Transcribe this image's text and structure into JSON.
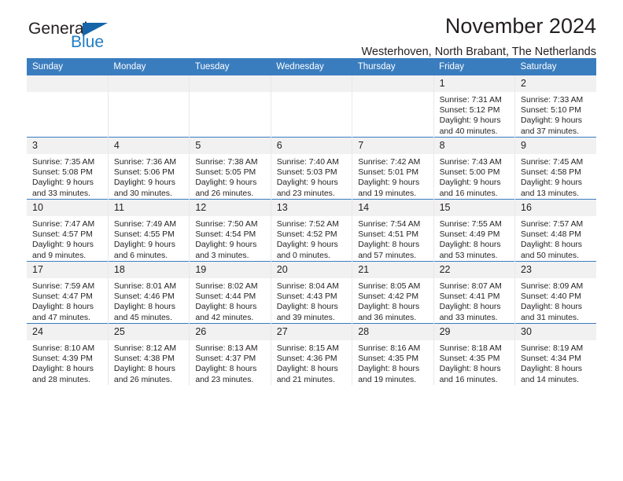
{
  "brand": {
    "name_part1": "General",
    "name_part2": "Blue",
    "triangle_color": "#1565a8",
    "blue_color": "#1f7ec4"
  },
  "header": {
    "title": "November 2024",
    "subtitle": "Westerhoven, North Brabant, The Netherlands"
  },
  "theme": {
    "header_bar": "#3a7dbf",
    "day_band": "#f1f1f1",
    "text": "#231f20"
  },
  "weekday_headers": [
    "Sunday",
    "Monday",
    "Tuesday",
    "Wednesday",
    "Thursday",
    "Friday",
    "Saturday"
  ],
  "weeks": [
    [
      {
        "day": "",
        "empty": true
      },
      {
        "day": "",
        "empty": true
      },
      {
        "day": "",
        "empty": true
      },
      {
        "day": "",
        "empty": true
      },
      {
        "day": "",
        "empty": true
      },
      {
        "day": "1",
        "sunrise": "Sunrise: 7:31 AM",
        "sunset": "Sunset: 5:12 PM",
        "daylight1": "Daylight: 9 hours",
        "daylight2": "and 40 minutes."
      },
      {
        "day": "2",
        "sunrise": "Sunrise: 7:33 AM",
        "sunset": "Sunset: 5:10 PM",
        "daylight1": "Daylight: 9 hours",
        "daylight2": "and 37 minutes."
      }
    ],
    [
      {
        "day": "3",
        "sunrise": "Sunrise: 7:35 AM",
        "sunset": "Sunset: 5:08 PM",
        "daylight1": "Daylight: 9 hours",
        "daylight2": "and 33 minutes."
      },
      {
        "day": "4",
        "sunrise": "Sunrise: 7:36 AM",
        "sunset": "Sunset: 5:06 PM",
        "daylight1": "Daylight: 9 hours",
        "daylight2": "and 30 minutes."
      },
      {
        "day": "5",
        "sunrise": "Sunrise: 7:38 AM",
        "sunset": "Sunset: 5:05 PM",
        "daylight1": "Daylight: 9 hours",
        "daylight2": "and 26 minutes."
      },
      {
        "day": "6",
        "sunrise": "Sunrise: 7:40 AM",
        "sunset": "Sunset: 5:03 PM",
        "daylight1": "Daylight: 9 hours",
        "daylight2": "and 23 minutes."
      },
      {
        "day": "7",
        "sunrise": "Sunrise: 7:42 AM",
        "sunset": "Sunset: 5:01 PM",
        "daylight1": "Daylight: 9 hours",
        "daylight2": "and 19 minutes."
      },
      {
        "day": "8",
        "sunrise": "Sunrise: 7:43 AM",
        "sunset": "Sunset: 5:00 PM",
        "daylight1": "Daylight: 9 hours",
        "daylight2": "and 16 minutes."
      },
      {
        "day": "9",
        "sunrise": "Sunrise: 7:45 AM",
        "sunset": "Sunset: 4:58 PM",
        "daylight1": "Daylight: 9 hours",
        "daylight2": "and 13 minutes."
      }
    ],
    [
      {
        "day": "10",
        "sunrise": "Sunrise: 7:47 AM",
        "sunset": "Sunset: 4:57 PM",
        "daylight1": "Daylight: 9 hours",
        "daylight2": "and 9 minutes."
      },
      {
        "day": "11",
        "sunrise": "Sunrise: 7:49 AM",
        "sunset": "Sunset: 4:55 PM",
        "daylight1": "Daylight: 9 hours",
        "daylight2": "and 6 minutes."
      },
      {
        "day": "12",
        "sunrise": "Sunrise: 7:50 AM",
        "sunset": "Sunset: 4:54 PM",
        "daylight1": "Daylight: 9 hours",
        "daylight2": "and 3 minutes."
      },
      {
        "day": "13",
        "sunrise": "Sunrise: 7:52 AM",
        "sunset": "Sunset: 4:52 PM",
        "daylight1": "Daylight: 9 hours",
        "daylight2": "and 0 minutes."
      },
      {
        "day": "14",
        "sunrise": "Sunrise: 7:54 AM",
        "sunset": "Sunset: 4:51 PM",
        "daylight1": "Daylight: 8 hours",
        "daylight2": "and 57 minutes."
      },
      {
        "day": "15",
        "sunrise": "Sunrise: 7:55 AM",
        "sunset": "Sunset: 4:49 PM",
        "daylight1": "Daylight: 8 hours",
        "daylight2": "and 53 minutes."
      },
      {
        "day": "16",
        "sunrise": "Sunrise: 7:57 AM",
        "sunset": "Sunset: 4:48 PM",
        "daylight1": "Daylight: 8 hours",
        "daylight2": "and 50 minutes."
      }
    ],
    [
      {
        "day": "17",
        "sunrise": "Sunrise: 7:59 AM",
        "sunset": "Sunset: 4:47 PM",
        "daylight1": "Daylight: 8 hours",
        "daylight2": "and 47 minutes."
      },
      {
        "day": "18",
        "sunrise": "Sunrise: 8:01 AM",
        "sunset": "Sunset: 4:46 PM",
        "daylight1": "Daylight: 8 hours",
        "daylight2": "and 45 minutes."
      },
      {
        "day": "19",
        "sunrise": "Sunrise: 8:02 AM",
        "sunset": "Sunset: 4:44 PM",
        "daylight1": "Daylight: 8 hours",
        "daylight2": "and 42 minutes."
      },
      {
        "day": "20",
        "sunrise": "Sunrise: 8:04 AM",
        "sunset": "Sunset: 4:43 PM",
        "daylight1": "Daylight: 8 hours",
        "daylight2": "and 39 minutes."
      },
      {
        "day": "21",
        "sunrise": "Sunrise: 8:05 AM",
        "sunset": "Sunset: 4:42 PM",
        "daylight1": "Daylight: 8 hours",
        "daylight2": "and 36 minutes."
      },
      {
        "day": "22",
        "sunrise": "Sunrise: 8:07 AM",
        "sunset": "Sunset: 4:41 PM",
        "daylight1": "Daylight: 8 hours",
        "daylight2": "and 33 minutes."
      },
      {
        "day": "23",
        "sunrise": "Sunrise: 8:09 AM",
        "sunset": "Sunset: 4:40 PM",
        "daylight1": "Daylight: 8 hours",
        "daylight2": "and 31 minutes."
      }
    ],
    [
      {
        "day": "24",
        "sunrise": "Sunrise: 8:10 AM",
        "sunset": "Sunset: 4:39 PM",
        "daylight1": "Daylight: 8 hours",
        "daylight2": "and 28 minutes."
      },
      {
        "day": "25",
        "sunrise": "Sunrise: 8:12 AM",
        "sunset": "Sunset: 4:38 PM",
        "daylight1": "Daylight: 8 hours",
        "daylight2": "and 26 minutes."
      },
      {
        "day": "26",
        "sunrise": "Sunrise: 8:13 AM",
        "sunset": "Sunset: 4:37 PM",
        "daylight1": "Daylight: 8 hours",
        "daylight2": "and 23 minutes."
      },
      {
        "day": "27",
        "sunrise": "Sunrise: 8:15 AM",
        "sunset": "Sunset: 4:36 PM",
        "daylight1": "Daylight: 8 hours",
        "daylight2": "and 21 minutes."
      },
      {
        "day": "28",
        "sunrise": "Sunrise: 8:16 AM",
        "sunset": "Sunset: 4:35 PM",
        "daylight1": "Daylight: 8 hours",
        "daylight2": "and 19 minutes."
      },
      {
        "day": "29",
        "sunrise": "Sunrise: 8:18 AM",
        "sunset": "Sunset: 4:35 PM",
        "daylight1": "Daylight: 8 hours",
        "daylight2": "and 16 minutes."
      },
      {
        "day": "30",
        "sunrise": "Sunrise: 8:19 AM",
        "sunset": "Sunset: 4:34 PM",
        "daylight1": "Daylight: 8 hours",
        "daylight2": "and 14 minutes."
      }
    ]
  ]
}
